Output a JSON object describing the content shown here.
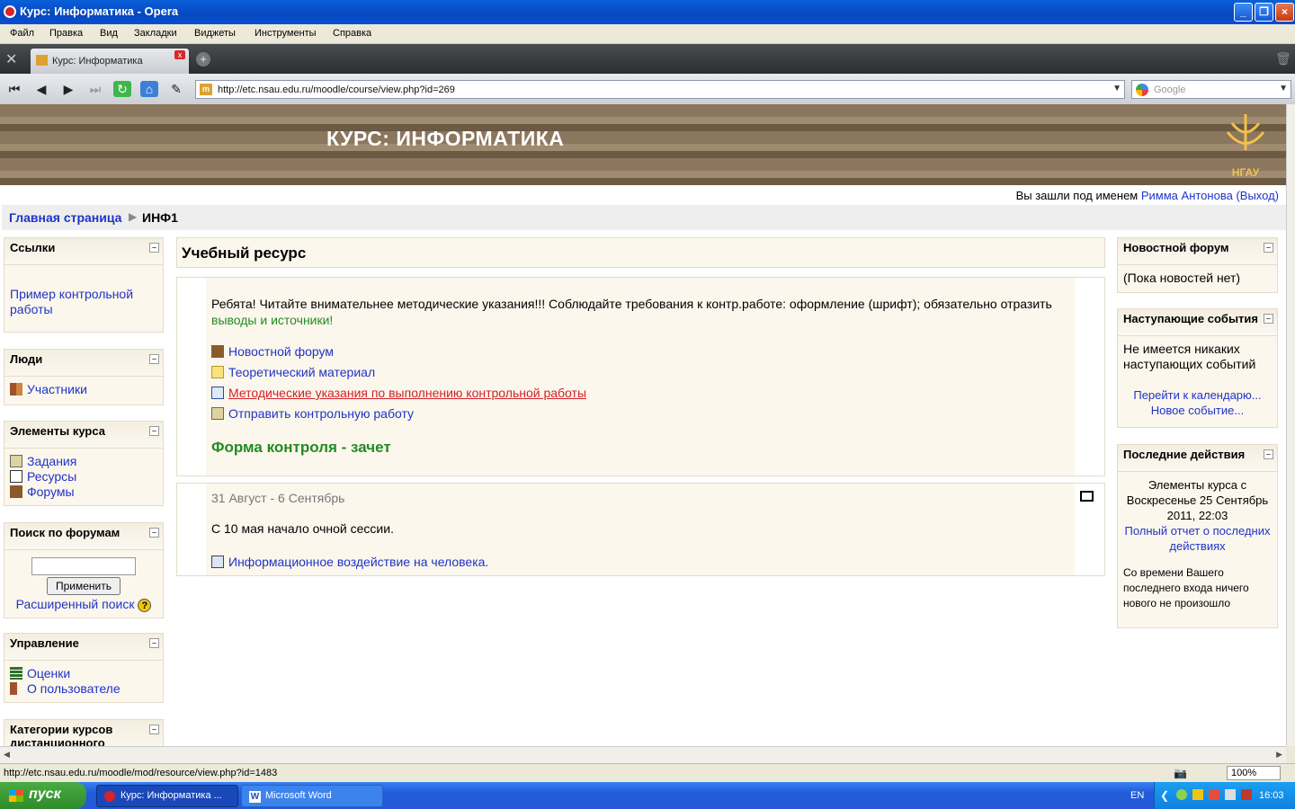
{
  "window": {
    "title": "Курс: Информатика - Opera"
  },
  "menu": [
    "Файл",
    "Правка",
    "Вид",
    "Закладки",
    "Виджеты",
    "Инструменты",
    "Справка"
  ],
  "tab": {
    "label": "Курс: Информатика",
    "close": "x"
  },
  "address": {
    "url": "http://etc.nsau.edu.ru/moodle/course/view.php?id=269",
    "search_placeholder": "Google"
  },
  "banner": {
    "title": "КУРС: ИНФОРМАТИКА",
    "logo_text": "НГАУ"
  },
  "login": {
    "prefix": "Вы зашли под именем",
    "user": "Римма Антонова",
    "logout": "(Выход)"
  },
  "breadcrumb": {
    "home": "Главная страница",
    "sep": "▶",
    "current": "ИНФ1"
  },
  "left": {
    "links": {
      "title": "Ссылки",
      "item": "Пример контрольной работы"
    },
    "people": {
      "title": "Люди",
      "item": "Участники"
    },
    "elements": {
      "title": "Элементы курса",
      "items": [
        "Задания",
        "Ресурсы",
        "Форумы"
      ]
    },
    "search": {
      "title": "Поиск по форумам",
      "button": "Применить",
      "advanced": "Расширенный поиск",
      "help": "?"
    },
    "admin": {
      "title": "Управление",
      "items": [
        "Оценки",
        "О пользователе"
      ]
    },
    "categories": {
      "title": "Категории курсов дистанционного"
    }
  },
  "main": {
    "section0": {
      "heading": "Учебный ресурс",
      "text1": "Ребята! Читайте внимательнее методические указания!!! Соблюдайте требования к контр.работе: оформление (шрифт); обязательно отразить",
      "text1_green": "выводы и источники!",
      "items": [
        "Новостной форум",
        "Теоретический материал",
        "Методические указания по выполнению контрольной работы",
        "Отправить контрольную работу"
      ],
      "footer": "Форма контроля - зачет"
    },
    "section1": {
      "date": "31 Август - 6 Сентябрь",
      "text": "С 10 мая начало очной сессии.",
      "item": "Информационное воздействие на человека."
    }
  },
  "right": {
    "news": {
      "title": "Новостной форум",
      "text": "(Пока новостей нет)"
    },
    "events": {
      "title": "Наступающие события",
      "text": "Не имеется никаких наступающих событий",
      "link1": "Перейти к календарю...",
      "link2": "Новое событие..."
    },
    "recent": {
      "title": "Последние действия",
      "text1": "Элементы курса с Воскресенье 25 Сентябрь 2011, 22:03",
      "link": "Полный отчет о последних действиях",
      "text2": "Со времени Вашего последнего входа ничего нового не произошло"
    }
  },
  "status": {
    "url": "http://etc.nsau.edu.ru/moodle/mod/resource/view.php?id=1483",
    "zoom": "100%"
  },
  "taskbar": {
    "start": "пуск",
    "btn1": "Курс: Информатика ...",
    "btn2": "Microsoft Word",
    "lang": "EN",
    "time": "16:03"
  }
}
